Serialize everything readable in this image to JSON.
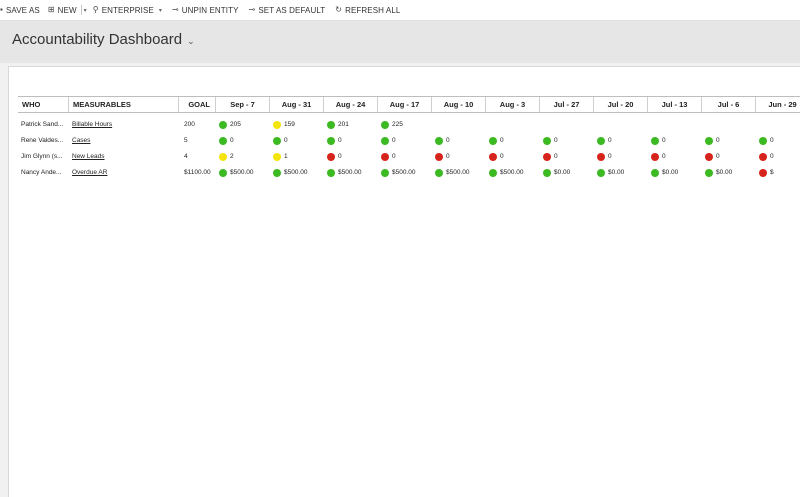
{
  "toolbar": {
    "save_as": "SAVE AS",
    "new": "NEW",
    "enterprise": "ENTERPRISE",
    "unpin_entity": "UNPIN ENTITY",
    "set_as_default": "SET AS DEFAULT",
    "refresh_all": "REFRESH ALL"
  },
  "header": {
    "title": "Accountability Dashboard"
  },
  "table": {
    "col_who": "WHO",
    "col_measurables": "MEASURABLES",
    "col_goal": "GOAL",
    "weeks": [
      "Sep - 7",
      "Aug - 31",
      "Aug - 24",
      "Aug - 17",
      "Aug - 10",
      "Aug - 3",
      "Jul - 27",
      "Jul - 20",
      "Jul - 13",
      "Jul - 6",
      "Jun - 29"
    ],
    "rows": [
      {
        "who": "Patrick Sand...",
        "measurable": "Billable Hours",
        "goal": "200",
        "cells": [
          {
            "status": "green",
            "value": "205"
          },
          {
            "status": "yellow",
            "value": "159"
          },
          {
            "status": "green",
            "value": "201"
          },
          {
            "status": "green",
            "value": "225"
          }
        ]
      },
      {
        "who": "Rene Valdes...",
        "measurable": "Cases",
        "goal": "5",
        "cells": [
          {
            "status": "green",
            "value": "0"
          },
          {
            "status": "green",
            "value": "0"
          },
          {
            "status": "green",
            "value": "0"
          },
          {
            "status": "green",
            "value": "0"
          },
          {
            "status": "green",
            "value": "0"
          },
          {
            "status": "green",
            "value": "0"
          },
          {
            "status": "green",
            "value": "0"
          },
          {
            "status": "green",
            "value": "0"
          },
          {
            "status": "green",
            "value": "0"
          },
          {
            "status": "green",
            "value": "0"
          },
          {
            "status": "green",
            "value": "0"
          }
        ]
      },
      {
        "who": "Jim Glynn (s...",
        "measurable": "New Leads",
        "goal": "4",
        "cells": [
          {
            "status": "yellow",
            "value": "2"
          },
          {
            "status": "yellow",
            "value": "1"
          },
          {
            "status": "red",
            "value": "0"
          },
          {
            "status": "red",
            "value": "0"
          },
          {
            "status": "red",
            "value": "0"
          },
          {
            "status": "red",
            "value": "0"
          },
          {
            "status": "red",
            "value": "0"
          },
          {
            "status": "red",
            "value": "0"
          },
          {
            "status": "red",
            "value": "0"
          },
          {
            "status": "red",
            "value": "0"
          },
          {
            "status": "red",
            "value": "0"
          }
        ]
      },
      {
        "who": "Nancy Ande...",
        "measurable": "Overdue AR",
        "goal": "$1100.00",
        "cells": [
          {
            "status": "green",
            "value": "$500.00"
          },
          {
            "status": "green",
            "value": "$500.00"
          },
          {
            "status": "green",
            "value": "$500.00"
          },
          {
            "status": "green",
            "value": "$500.00"
          },
          {
            "status": "green",
            "value": "$500.00"
          },
          {
            "status": "green",
            "value": "$500.00"
          },
          {
            "status": "green",
            "value": "$0.00"
          },
          {
            "status": "green",
            "value": "$0.00"
          },
          {
            "status": "green",
            "value": "$0.00"
          },
          {
            "status": "green",
            "value": "$0.00"
          },
          {
            "status": "red",
            "value": "$"
          }
        ]
      }
    ]
  },
  "status_colors": {
    "green": "#3cba22",
    "yellow": "#f4e40c",
    "red": "#d6231c"
  },
  "icons": {
    "save_as": "save-icon",
    "new": "new-grid-icon",
    "enterprise": "enterprise-icon",
    "unpin_entity": "unpin-icon",
    "set_as_default": "pin-icon",
    "refresh_all": "refresh-icon"
  }
}
